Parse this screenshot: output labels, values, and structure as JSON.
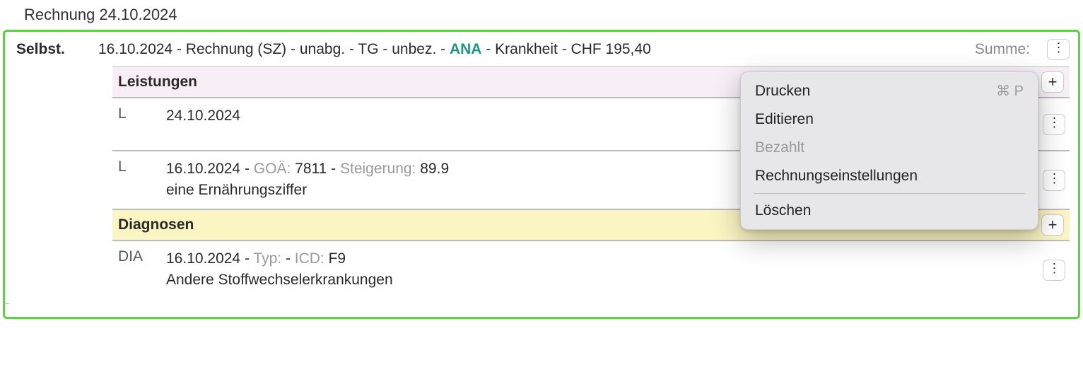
{
  "page_title": "Rechnung 24.10.2024",
  "header": {
    "left_label": "Selbst.",
    "date": "16.10.2024",
    "type": "Rechnung (SZ)",
    "status1": "unabg.",
    "status2": "TG",
    "status3": "unbez.",
    "code": "ANA",
    "reason": "Krankheit",
    "amount": "CHF 195,40",
    "summe_label": "Summe:"
  },
  "sections": {
    "leistungen": {
      "title": "Leistungen",
      "rows": [
        {
          "tag": "L",
          "date": "24.10.2024",
          "goa_label": "",
          "goa_value": "",
          "steig_label": "",
          "steig_value": "",
          "desc": ""
        },
        {
          "tag": "L",
          "date": "16.10.2024",
          "goa_label": "GOÄ:",
          "goa_value": "7811",
          "steig_label": "Steigerung:",
          "steig_value": "89.9",
          "desc": "eine Ernährungsziffer"
        }
      ]
    },
    "diagnosen": {
      "title": "Diagnosen",
      "rows": [
        {
          "tag": "DIA",
          "date": "16.10.2024",
          "typ_label": "Typ:",
          "typ_value": "",
          "icd_label": "ICD:",
          "icd_value": "F9",
          "desc": "Andere Stoffwechselerkrankungen"
        }
      ]
    }
  },
  "menu": {
    "print": "Drucken",
    "print_shortcut": "⌘ P",
    "edit": "Editieren",
    "paid": "Bezahlt",
    "settings": "Rechnungseinstellungen",
    "delete": "Löschen"
  },
  "icons": {
    "plus": "+",
    "dots": "⋮",
    "minus": "–"
  }
}
